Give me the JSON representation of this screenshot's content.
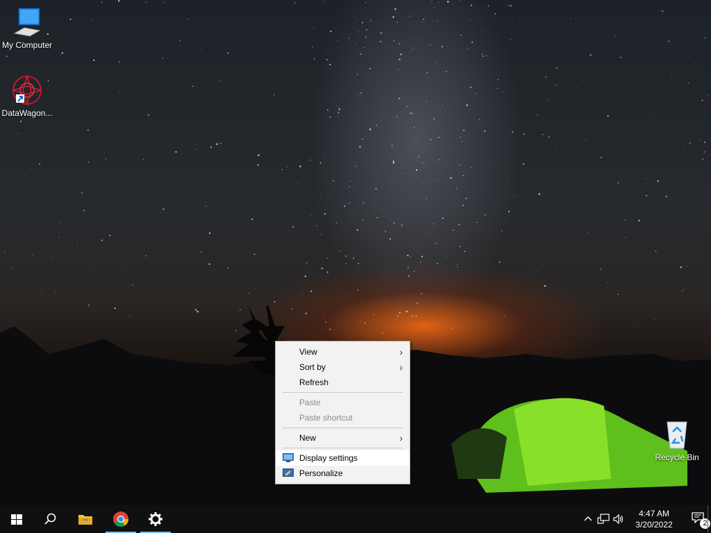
{
  "desktop": {
    "icons": [
      {
        "label": "My Computer",
        "icon": "computer-icon"
      },
      {
        "label": "DataWagon...",
        "icon": "datawagon-icon"
      },
      {
        "label": "Recycle Bin",
        "icon": "recycle-bin-icon"
      }
    ]
  },
  "context_menu": {
    "items": [
      {
        "label": "View",
        "submenu": true,
        "disabled": false
      },
      {
        "label": "Sort by",
        "submenu": true,
        "disabled": false
      },
      {
        "label": "Refresh",
        "submenu": false,
        "disabled": false
      },
      {
        "label": "Paste",
        "submenu": false,
        "disabled": true
      },
      {
        "label": "Paste shortcut",
        "submenu": false,
        "disabled": true
      },
      {
        "label": "New",
        "submenu": true,
        "disabled": false
      },
      {
        "label": "Display settings",
        "submenu": false,
        "disabled": false,
        "icon": "display-icon",
        "highlighted": true
      },
      {
        "label": "Personalize",
        "submenu": false,
        "disabled": false,
        "icon": "personalize-icon"
      }
    ],
    "chevron": "›"
  },
  "taskbar": {
    "buttons": [
      "windows-start-icon",
      "search-icon",
      "file-explorer-icon",
      "chrome-icon",
      "settings-icon"
    ],
    "clock": {
      "time": "4:47 AM",
      "date": "3/20/2022"
    },
    "notification_count": "2",
    "tray_icons": [
      "chevron-up-icon",
      "network-icon",
      "volume-icon",
      "notification-icon"
    ]
  },
  "colors": {
    "taskbar": "#101010",
    "accent": "#76b9ed",
    "menu_bg": "#f2f2f2"
  }
}
